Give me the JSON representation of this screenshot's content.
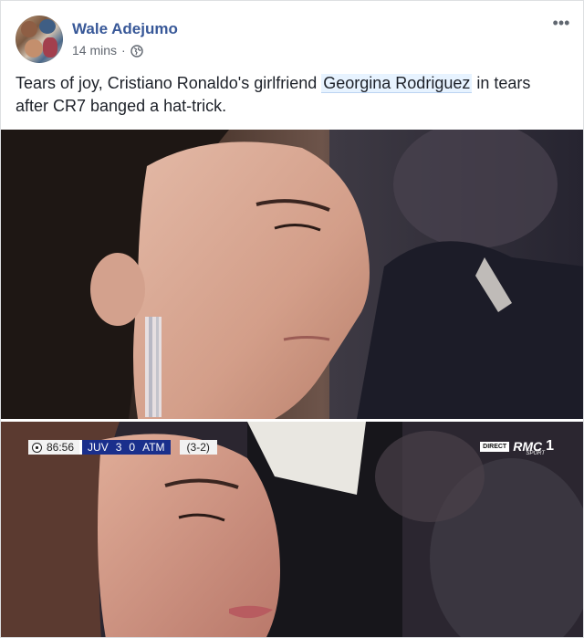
{
  "post": {
    "author": "Wale Adejumo",
    "time": "14 mins",
    "separator": "·",
    "privacy_icon": "globe-icon",
    "more_icon": "ellipsis-icon",
    "more_label": "•••",
    "caption_before": "Tears of joy, Cristiano Ronaldo's girlfriend ",
    "caption_tag": "Georgina Rodriguez",
    "caption_after": " in tears after CR7 banged a hat-trick."
  },
  "scoreboard": {
    "clock": "86:56",
    "home": "JUV",
    "home_score": "3",
    "away_score": "0",
    "away": "ATM",
    "aggregate": "(3-2)"
  },
  "broadcaster": {
    "direct": "DIRECT",
    "brand": "RMC",
    "sub": "SPORT",
    "channel": "1"
  },
  "colors": {
    "link": "#385898",
    "tag_bg": "#e7f3ff",
    "meta_text": "#616770",
    "scoreboard_blue": "#1a2f8c"
  }
}
